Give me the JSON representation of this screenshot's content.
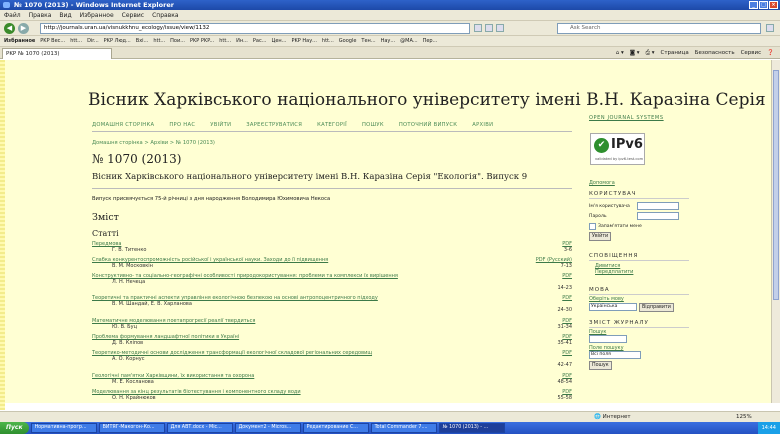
{
  "window": {
    "title": "№ 1070 (2013) - Windows Internet Explorer"
  },
  "menu": [
    "Файл",
    "Правка",
    "Вид",
    "Избранное",
    "Сервис",
    "Справка"
  ],
  "address": {
    "url": "http://journals.uran.ua/visnukkhnu_ecology/issue/view/1132",
    "search_placeholder": "Ask Search"
  },
  "favorites": [
    "Избранное",
    "PKP Вес...",
    "htt...",
    "Dir...",
    "PKP Люд...",
    "Вхі...",
    "htt...",
    "Пои...",
    "PKP PKP...",
    "htt...",
    "Ин...",
    "Рас...",
    "Цен...",
    "PKP Нау...",
    "htt...",
    "Google",
    "Тен...",
    "Нау...",
    "@MA...",
    "Пер..."
  ],
  "tab": {
    "label": "PKP № 1070 (2013)"
  },
  "commands": [
    "Страница",
    "Безопасность",
    "Сервис"
  ],
  "site": {
    "header": "Вісник Харківського національного університету імені В.Н. Каразіна Серія \"Екологія\"",
    "nav": [
      "ДОМАШНЯ СТОРІНКА",
      "ПРО НАС",
      "УВІЙТИ",
      "ЗАРЕЄСТРУВАТИСЯ",
      "КАТЕГОРІЇ",
      "ПОШУК",
      "ПОТОЧНИЙ ВИПУСК",
      "АРХІВИ"
    ],
    "breadcrumb": "Домашня сторінка > Архіви > № 1070 (2013)",
    "issue_title": "№ 1070 (2013)",
    "subtitle": "Вісник Харківського національного університету імені В.Н. Каразіна Серія \"Екологія\". Випуск 9",
    "description": "Випуск присвячується 75-й річниці з дня народження Володимира Юхимовича Некоса",
    "toc_heading": "Зміст",
    "section": "Статті",
    "articles": [
      {
        "title": "Передмова",
        "author": "Г. В. Титенко",
        "pdf": "PDF",
        "pages": "3-6"
      },
      {
        "title": "Слабка конкурентоспроможність російської і української науки. Заходи до її підвищення",
        "author": "В. М. Московкін",
        "pdf": "PDF (Русский)",
        "pages": "7-13"
      },
      {
        "title": "Конструктивно- та соціально-географічні особливості природокористування: проблеми та комплекси їх вирішення",
        "author": "Л. Н. Нечеца",
        "pdf": "PDF",
        "pages": "14-23"
      },
      {
        "title": "Теоретичні та практичні аспекти управління екологічною безпекою на основі антропоцентричного підходу",
        "author": "В. М. Шандай, Е. В. Харланова",
        "pdf": "PDF",
        "pages": "24-30"
      },
      {
        "title": "Математичне моделювання поетапрогресії реалії твердиться",
        "author": "Ю. В. Буц",
        "pdf": "PDF",
        "pages": "31-34"
      },
      {
        "title": "Проблема формування ландшафтної політики в Україні",
        "author": "Д. В. Кліпов",
        "pdf": "PDF",
        "pages": "35-41"
      },
      {
        "title": "Теоретико-методичні основи дослідження трансформації екологічної складової регіональних середовищ",
        "author": "А. О. Корнус",
        "pdf": "PDF",
        "pages": "42-47"
      },
      {
        "title": "Геологічні пам'ятки Харківщини, їх використання та охорона",
        "author": "М. Е. Косланова",
        "pdf": "PDF",
        "pages": "48-54"
      },
      {
        "title": "Моделювання за кінц результатів біотестування і компонентного складу води",
        "author": "О. Н. Крайнюков",
        "pdf": "PDF",
        "pages": "55-58"
      }
    ],
    "sidebar": {
      "ojs": "OPEN JOURNAL SYSTEMS",
      "ipv6": "IPv6",
      "ipv6_sub": "validated by ipv6-test.com",
      "help": "Допомога",
      "user_heading": "КОРИСТУВАЧ",
      "username_label": "Ім'я користувача",
      "password_label": "Пароль",
      "remember": "Запам'ятати мене",
      "login": "Увійти",
      "notify_heading": "СПОВІЩЕННЯ",
      "notify_links": [
        "Дивитися",
        "Передплатити"
      ],
      "lang_heading": "МОВА",
      "lang_label": "Оберіть мову",
      "lang_value": "Українська",
      "lang_submit": "Відправити",
      "content_heading": "ЗМІСТ ЖУРНАЛУ",
      "search_label": "Пошук",
      "field_label": "Поле пошуку",
      "field_value": "Всі поля",
      "search_button": "Пошук"
    }
  },
  "status": {
    "zone": "Интернет",
    "zoom": "125%"
  },
  "taskbar": {
    "start": "Пуск",
    "items": [
      "Нормативна-прогр...",
      "ВИТЯГ-Макогон-Ко...",
      "Для АВТ.docx - Mic...",
      "Документ2 - Micros...",
      "Редактирование С...",
      "Total Commander 7....",
      "№ 1070 (2013) - ..."
    ],
    "clock": "14:44"
  }
}
